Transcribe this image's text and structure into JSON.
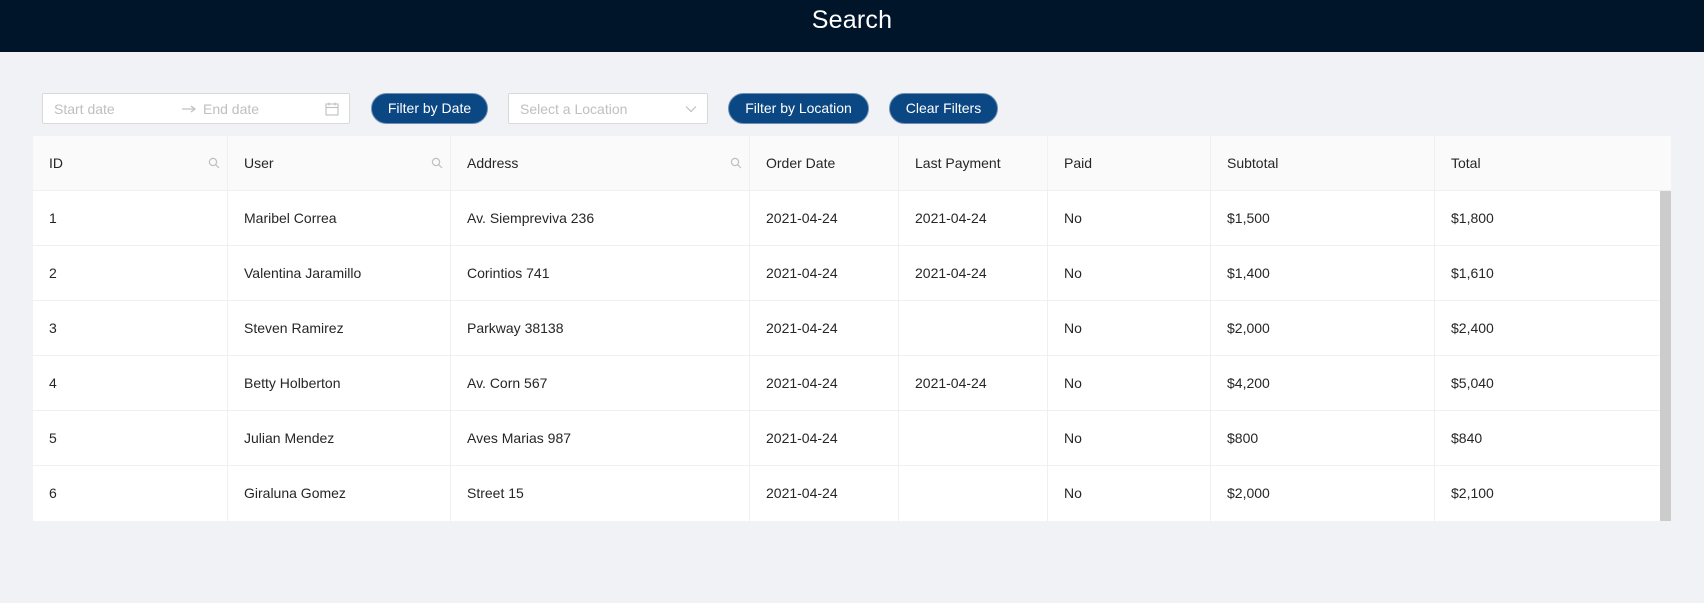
{
  "header": {
    "title": "Search"
  },
  "filters": {
    "start_placeholder": "Start date",
    "end_placeholder": "End date",
    "filter_date_label": "Filter by Date",
    "location_placeholder": "Select a Location",
    "filter_location_label": "Filter by Location",
    "clear_label": "Clear Filters"
  },
  "table": {
    "columns": [
      "ID",
      "User",
      "Address",
      "Order Date",
      "Last Payment",
      "Paid",
      "Subtotal",
      "Total"
    ],
    "rows": [
      [
        "1",
        "Maribel Correa",
        "Av. Siempreviva 236",
        "2021-04-24",
        "2021-04-24",
        "No",
        "$1,500",
        "$1,800"
      ],
      [
        "2",
        "Valentina Jaramillo",
        "Corintios 741",
        "2021-04-24",
        "2021-04-24",
        "No",
        "$1,400",
        "$1,610"
      ],
      [
        "3",
        "Steven Ramirez",
        "Parkway 38138",
        "2021-04-24",
        "",
        "No",
        "$2,000",
        "$2,400"
      ],
      [
        "4",
        "Betty Holberton",
        "Av. Corn 567",
        "2021-04-24",
        "2021-04-24",
        "No",
        "$4,200",
        "$5,040"
      ],
      [
        "5",
        "Julian Mendez",
        "Aves Marias 987",
        "2021-04-24",
        "",
        "No",
        "$800",
        "$840"
      ],
      [
        "6",
        "Giraluna Gomez",
        "Street 15",
        "2021-04-24",
        "",
        "No",
        "$2,000",
        "$2,100"
      ]
    ]
  },
  "icons": {
    "column_search": "search-icon",
    "range_separator": "arrow-right-icon",
    "calendar": "calendar-icon",
    "select_arrow": "chevron-down-icon"
  },
  "colors": {
    "header_bg": "#001529",
    "button_bg": "#0b4782",
    "page_bg": "#f0f2f5"
  }
}
